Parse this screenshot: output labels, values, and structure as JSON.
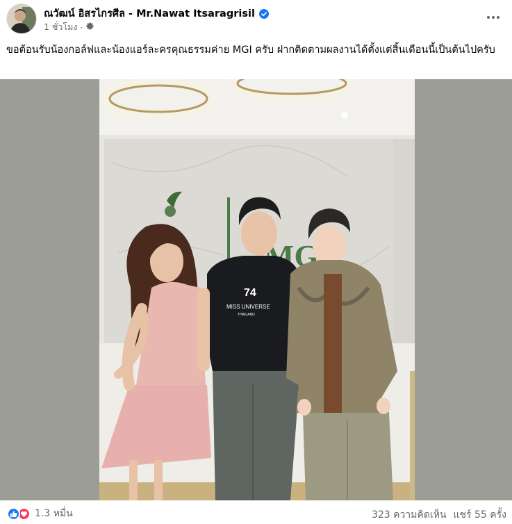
{
  "post": {
    "author": "ณวัฒน์ อิสรไกรศีล - Mr.Nawat Itsaragrisil",
    "time": "1 ชั่วโมง",
    "separator": "·",
    "privacy_icon": "gear-icon",
    "caption": "ขอต้อนรับน้องกอล์ฟและน้องแอร์ละครคุณธรรมค่าย MGI ครับ ฝากติดตามผลงานได้ตั้งแต่สิ้นเดือนนี้เป็นต้นไปครับ",
    "photo": {
      "wall_logo": "MGI",
      "shirt_number": "74",
      "shirt_text": "MISS UNIVERSE",
      "shirt_country": "THAILAND"
    }
  },
  "footer": {
    "reactions_count": "1.3 หมื่น",
    "comments": "323 ความคิดเห็น",
    "shares": "แชร์ 55 ครั้ง"
  },
  "colors": {
    "accent": "#1877f2",
    "love": "#f33e58",
    "secondary_text": "#65676b"
  }
}
